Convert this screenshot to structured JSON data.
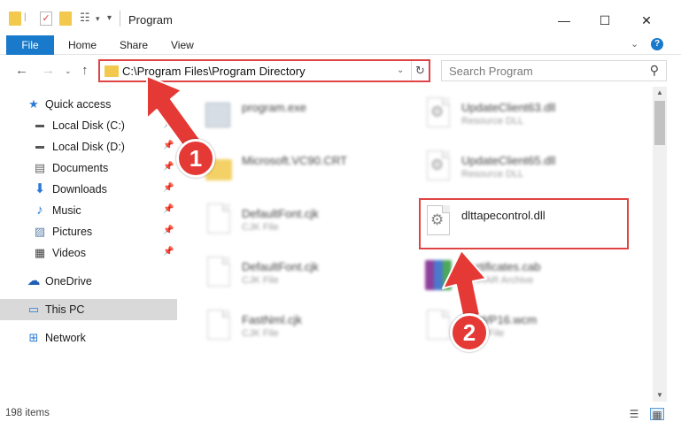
{
  "window": {
    "title": "Program"
  },
  "ribbon": {
    "file": "File",
    "tabs": [
      "Home",
      "Share",
      "View"
    ],
    "help": "?"
  },
  "nav": {
    "address": "C:\\Program Files\\Program Directory",
    "search_placeholder": "Search Program"
  },
  "sidebar": {
    "items": [
      {
        "label": "Quick access",
        "icon": "star-icon"
      },
      {
        "label": "Local Disk (C:)",
        "icon": "drive-icon",
        "pinned": true
      },
      {
        "label": "Local Disk (D:)",
        "icon": "drive-icon",
        "pinned": true
      },
      {
        "label": "Documents",
        "icon": "documents-icon",
        "pinned": true
      },
      {
        "label": "Downloads",
        "icon": "download-icon",
        "pinned": true
      },
      {
        "label": "Music",
        "icon": "music-icon",
        "pinned": true
      },
      {
        "label": "Pictures",
        "icon": "pictures-icon",
        "pinned": true
      },
      {
        "label": "Videos",
        "icon": "videos-icon",
        "pinned": true
      },
      {
        "label": "OneDrive",
        "icon": "cloud-icon"
      },
      {
        "label": "This PC",
        "icon": "computer-icon",
        "selected": true
      },
      {
        "label": "Network",
        "icon": "network-icon"
      }
    ]
  },
  "files": {
    "left": [
      {
        "name": "program.exe",
        "type": "",
        "icon": "exe-icon"
      },
      {
        "name": "Microsoft.VC90.CRT",
        "type": "",
        "icon": "folder-icon"
      },
      {
        "name": "DefaultFont.cjk",
        "type": "CJK File",
        "icon": "file-icon"
      },
      {
        "name": "DefaultFont.cjk",
        "type": "CJK File",
        "icon": "file-icon"
      },
      {
        "name": "FastNml.cjk",
        "type": "CJK File",
        "icon": "file-icon"
      }
    ],
    "right": [
      {
        "name": "UpdateClient63.dll",
        "type": "Resource DLL",
        "icon": "dll-icon"
      },
      {
        "name": "UpdateClient65.dll",
        "type": "Resource DLL",
        "icon": "dll-icon"
      },
      {
        "name": "dlttapecontrol.dll",
        "type": "",
        "icon": "dll-icon",
        "highlighted": true
      },
      {
        "name": "Certificates.cab",
        "type": "WinRAR Archive",
        "icon": "archive-icon"
      },
      {
        "name": "MSWP16.wcm",
        "type": "WCM File",
        "icon": "file-icon"
      }
    ]
  },
  "status": {
    "count": "198 items"
  },
  "callouts": {
    "step1": "1",
    "step2": "2"
  },
  "colors": {
    "accent": "#1979ca",
    "highlight": "#e04343",
    "callout": "#e53935"
  }
}
